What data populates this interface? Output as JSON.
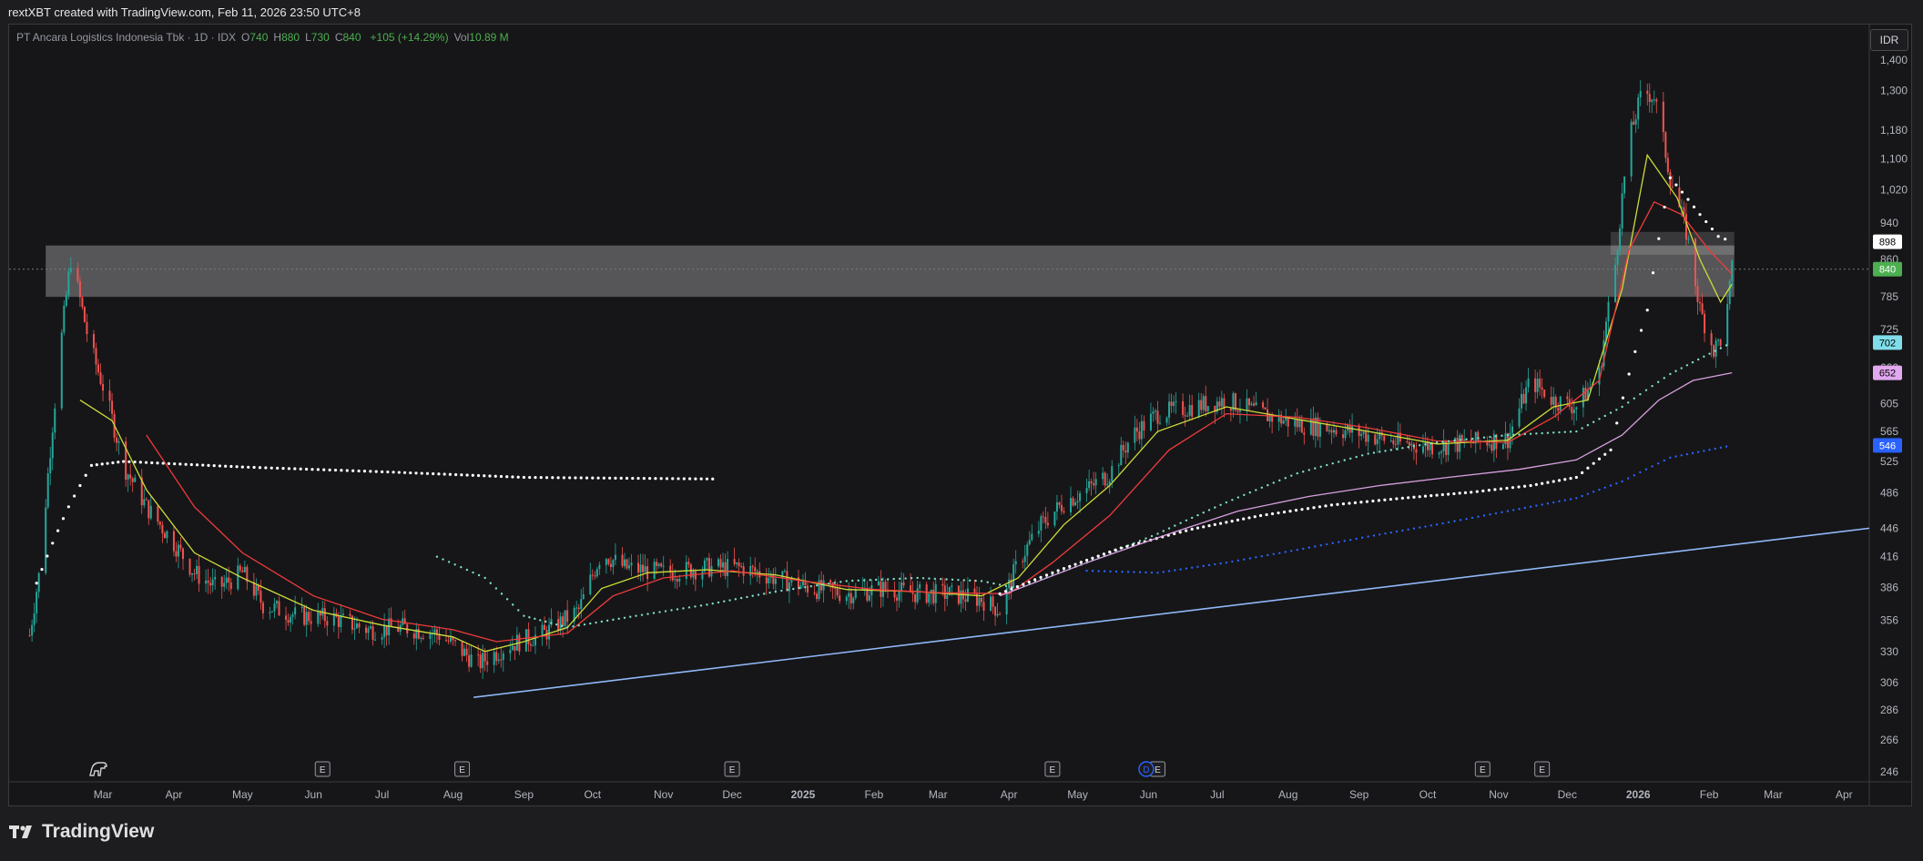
{
  "caption": "rextXBT created with TradingView.com, Feb 11, 2026 23:50 UTC+8",
  "legend": {
    "symbol": "PT Ancara Logistics Indonesia Tbk · 1D · IDX",
    "o_label": "O",
    "o": "740",
    "h_label": "H",
    "h": "880",
    "l_label": "L",
    "l": "730",
    "c_label": "C",
    "c": "840",
    "change": "+105 (+14.29%)",
    "vol_label": "Vol",
    "vol": "10.89 M"
  },
  "currency": "IDR",
  "brand": "TradingView",
  "colors": {
    "up": "#26a69a",
    "down": "#ef5350",
    "sma_fast": "#cddc39",
    "sma_mid": "#ef3b3b",
    "teal_dots": "#7ee0c8",
    "white_dots": "#ffffff",
    "violet": "#d8a0e0",
    "blue_dots": "#2962ff",
    "trendline": "#90b8f8",
    "zone": "#ffffff"
  },
  "chart_data": {
    "type": "line",
    "title": "",
    "xlabel": "",
    "ylabel": "",
    "scale": "log",
    "ylim": [
      240,
      1500
    ],
    "y_ticks": [
      246,
      266,
      286,
      306,
      330,
      356,
      386,
      416,
      446,
      486,
      525,
      565,
      605,
      660,
      725,
      785,
      860,
      940,
      1020,
      1100,
      1180,
      1300,
      1400
    ],
    "x_ticks": [
      "Mar",
      "Apr",
      "May",
      "Jun",
      "Jul",
      "Aug",
      "Sep",
      "Oct",
      "Nov",
      "Dec",
      "2025",
      "Feb",
      "Mar",
      "Apr",
      "May",
      "Jun",
      "Jul",
      "Aug",
      "Sep",
      "Oct",
      "Nov",
      "Dec",
      "2026",
      "Feb",
      "Mar",
      "Apr"
    ],
    "price_tags": [
      {
        "value": 898,
        "color": "#ffffff",
        "text_color": "#000000"
      },
      {
        "value": 840,
        "color": "#4caf50",
        "text_color": "#ffffff"
      },
      {
        "value": 702,
        "color": "#80deea",
        "text_color": "#000000"
      },
      {
        "value": 652,
        "color": "#e1a8f0",
        "text_color": "#000000"
      },
      {
        "value": 546,
        "color": "#2962ff",
        "text_color": "#ffffff"
      }
    ],
    "zones": [
      {
        "from": "2024-02-05",
        "to": "2026-02-12",
        "low": 785,
        "high": 890
      },
      {
        "from": "2025-12-20",
        "to": "2026-02-12",
        "low": 870,
        "high": 920
      }
    ],
    "trendline": {
      "from": [
        "2024-08-10",
        295
      ],
      "to": [
        "2026-04-10",
        446
      ]
    },
    "earnings_markers": [
      "2024-06-05",
      "2024-08-05",
      "2024-12-01",
      "2025-04-20",
      "2025-06-05",
      "2025-10-25",
      "2025-11-20"
    ],
    "dividend_markers": [
      "2025-05-31"
    ],
    "price": [
      [
        "2024-01-28",
        330
      ],
      [
        "2024-02-03",
        410
      ],
      [
        "2024-02-10",
        640
      ],
      [
        "2024-02-16",
        860
      ],
      [
        "2024-02-24",
        700
      ],
      [
        "2024-03-02",
        620
      ],
      [
        "2024-03-10",
        520
      ],
      [
        "2024-03-20",
        470
      ],
      [
        "2024-04-01",
        430
      ],
      [
        "2024-04-10",
        400
      ],
      [
        "2024-04-20",
        385
      ],
      [
        "2024-05-01",
        400
      ],
      [
        "2024-05-10",
        370
      ],
      [
        "2024-05-25",
        360
      ],
      [
        "2024-06-10",
        358
      ],
      [
        "2024-06-25",
        348
      ],
      [
        "2024-07-10",
        350
      ],
      [
        "2024-07-25",
        345
      ],
      [
        "2024-08-05",
        330
      ],
      [
        "2024-08-12",
        320
      ],
      [
        "2024-08-25",
        335
      ],
      [
        "2024-09-10",
        345
      ],
      [
        "2024-09-25",
        365
      ],
      [
        "2024-10-05",
        420
      ],
      [
        "2024-10-15",
        405
      ],
      [
        "2024-11-01",
        400
      ],
      [
        "2024-11-20",
        405
      ],
      [
        "2024-12-05",
        405
      ],
      [
        "2024-12-20",
        395
      ],
      [
        "2025-01-05",
        385
      ],
      [
        "2025-01-20",
        380
      ],
      [
        "2025-02-05",
        385
      ],
      [
        "2025-02-20",
        380
      ],
      [
        "2025-03-05",
        380
      ],
      [
        "2025-03-20",
        375
      ],
      [
        "2025-03-28",
        365
      ],
      [
        "2025-04-05",
        410
      ],
      [
        "2025-04-15",
        450
      ],
      [
        "2025-04-25",
        475
      ],
      [
        "2025-05-05",
        490
      ],
      [
        "2025-05-15",
        510
      ],
      [
        "2025-05-25",
        560
      ],
      [
        "2025-06-05",
        590
      ],
      [
        "2025-06-20",
        600
      ],
      [
        "2025-07-05",
        610
      ],
      [
        "2025-07-20",
        590
      ],
      [
        "2025-08-05",
        575
      ],
      [
        "2025-08-20",
        570
      ],
      [
        "2025-09-05",
        560
      ],
      [
        "2025-09-20",
        548
      ],
      [
        "2025-10-05",
        545
      ],
      [
        "2025-10-20",
        550
      ],
      [
        "2025-11-05",
        555
      ],
      [
        "2025-11-15",
        640
      ],
      [
        "2025-11-25",
        610
      ],
      [
        "2025-12-05",
        600
      ],
      [
        "2025-12-15",
        650
      ],
      [
        "2025-12-22",
        850
      ],
      [
        "2025-12-28",
        1150
      ],
      [
        "2026-01-03",
        1300
      ],
      [
        "2026-01-08",
        1280
      ],
      [
        "2026-01-15",
        1050
      ],
      [
        "2026-01-22",
        920
      ],
      [
        "2026-01-28",
        760
      ],
      [
        "2026-02-03",
        690
      ],
      [
        "2026-02-08",
        720
      ],
      [
        "2026-02-11",
        840
      ]
    ],
    "series": [
      {
        "color": "#cddc39",
        "style": "line",
        "points": [
          [
            "2024-02-20",
            610
          ],
          [
            "2024-03-05",
            580
          ],
          [
            "2024-03-20",
            490
          ],
          [
            "2024-04-10",
            420
          ],
          [
            "2024-05-01",
            395
          ],
          [
            "2024-06-01",
            365
          ],
          [
            "2024-07-01",
            352
          ],
          [
            "2024-08-01",
            342
          ],
          [
            "2024-08-15",
            330
          ],
          [
            "2024-09-01",
            338
          ],
          [
            "2024-09-20",
            350
          ],
          [
            "2024-10-05",
            385
          ],
          [
            "2024-10-25",
            400
          ],
          [
            "2024-11-20",
            403
          ],
          [
            "2024-12-20",
            398
          ],
          [
            "2025-01-20",
            384
          ],
          [
            "2025-02-20",
            382
          ],
          [
            "2025-03-20",
            378
          ],
          [
            "2025-04-05",
            395
          ],
          [
            "2025-04-25",
            450
          ],
          [
            "2025-05-15",
            495
          ],
          [
            "2025-06-05",
            565
          ],
          [
            "2025-07-05",
            600
          ],
          [
            "2025-08-05",
            582
          ],
          [
            "2025-09-05",
            565
          ],
          [
            "2025-10-05",
            548
          ],
          [
            "2025-11-05",
            553
          ],
          [
            "2025-11-25",
            600
          ],
          [
            "2025-12-10",
            610
          ],
          [
            "2025-12-25",
            800
          ],
          [
            "2026-01-05",
            1110
          ],
          [
            "2026-01-18",
            1000
          ],
          [
            "2026-01-28",
            860
          ],
          [
            "2026-02-06",
            775
          ],
          [
            "2026-02-11",
            810
          ]
        ]
      },
      {
        "color": "#ef3b3b",
        "style": "line",
        "points": [
          [
            "2024-03-20",
            560
          ],
          [
            "2024-04-10",
            470
          ],
          [
            "2024-05-01",
            420
          ],
          [
            "2024-06-01",
            378
          ],
          [
            "2024-07-01",
            357
          ],
          [
            "2024-08-01",
            348
          ],
          [
            "2024-08-20",
            338
          ],
          [
            "2024-09-20",
            345
          ],
          [
            "2024-10-10",
            378
          ],
          [
            "2024-11-01",
            395
          ],
          [
            "2024-12-01",
            402
          ],
          [
            "2025-01-01",
            392
          ],
          [
            "2025-02-01",
            384
          ],
          [
            "2025-03-01",
            381
          ],
          [
            "2025-04-01",
            380
          ],
          [
            "2025-04-20",
            410
          ],
          [
            "2025-05-15",
            460
          ],
          [
            "2025-06-10",
            540
          ],
          [
            "2025-07-05",
            590
          ],
          [
            "2025-08-05",
            585
          ],
          [
            "2025-09-05",
            570
          ],
          [
            "2025-10-05",
            552
          ],
          [
            "2025-11-05",
            550
          ],
          [
            "2025-11-25",
            585
          ],
          [
            "2025-12-15",
            640
          ],
          [
            "2025-12-28",
            880
          ],
          [
            "2026-01-08",
            990
          ],
          [
            "2026-01-20",
            960
          ],
          [
            "2026-02-01",
            880
          ],
          [
            "2026-02-11",
            830
          ]
        ]
      },
      {
        "color": "#7ee0c8",
        "style": "dots",
        "points": [
          [
            "2024-07-25",
            416
          ],
          [
            "2024-08-15",
            395
          ],
          [
            "2024-09-01",
            360
          ],
          [
            "2024-09-20",
            350
          ],
          [
            "2024-10-20",
            360
          ],
          [
            "2024-11-20",
            370
          ],
          [
            "2024-12-20",
            382
          ],
          [
            "2025-01-20",
            392
          ],
          [
            "2025-02-20",
            395
          ],
          [
            "2025-03-20",
            392
          ],
          [
            "2025-04-05",
            385
          ],
          [
            "2025-05-05",
            410
          ],
          [
            "2025-06-05",
            440
          ],
          [
            "2025-07-05",
            475
          ],
          [
            "2025-08-05",
            510
          ],
          [
            "2025-09-05",
            535
          ],
          [
            "2025-10-05",
            550
          ],
          [
            "2025-11-05",
            560
          ],
          [
            "2025-12-05",
            565
          ],
          [
            "2025-12-25",
            600
          ],
          [
            "2026-01-15",
            650
          ],
          [
            "2026-02-11",
            702
          ]
        ]
      },
      {
        "color": "#ffffff",
        "style": "dots",
        "points": [
          [
            "2024-02-01",
            390
          ],
          [
            "2024-02-15",
            470
          ],
          [
            "2024-02-25",
            520
          ],
          [
            "2024-03-10",
            525
          ],
          [
            "2024-05-01",
            518
          ],
          [
            "2024-07-01",
            512
          ],
          [
            "2024-09-01",
            505
          ],
          [
            "2024-11-25",
            503
          ]
        ]
      },
      {
        "color": "#ffffff",
        "style": "dots",
        "points": [
          [
            "2025-03-28",
            380
          ],
          [
            "2025-04-20",
            400
          ],
          [
            "2025-05-20",
            425
          ],
          [
            "2025-06-20",
            445
          ],
          [
            "2025-07-20",
            460
          ],
          [
            "2025-08-20",
            472
          ],
          [
            "2025-09-20",
            480
          ],
          [
            "2025-10-20",
            487
          ],
          [
            "2025-11-15",
            495
          ],
          [
            "2025-12-05",
            505
          ],
          [
            "2025-12-20",
            540
          ],
          [
            "2026-01-05",
            760
          ],
          [
            "2026-01-15",
            1050
          ],
          [
            "2026-01-28",
            960
          ],
          [
            "2026-02-05",
            910
          ],
          [
            "2026-02-11",
            898
          ]
        ]
      },
      {
        "color": "#d8a0e0",
        "style": "line",
        "points": [
          [
            "2025-03-28",
            378
          ],
          [
            "2025-05-05",
            410
          ],
          [
            "2025-06-10",
            440
          ],
          [
            "2025-07-10",
            465
          ],
          [
            "2025-08-10",
            482
          ],
          [
            "2025-09-10",
            495
          ],
          [
            "2025-10-10",
            505
          ],
          [
            "2025-11-10",
            515
          ],
          [
            "2025-12-05",
            527
          ],
          [
            "2025-12-25",
            560
          ],
          [
            "2026-01-10",
            610
          ],
          [
            "2026-01-25",
            640
          ],
          [
            "2026-02-11",
            652
          ]
        ]
      },
      {
        "color": "#2962ff",
        "style": "dots",
        "points": [
          [
            "2025-05-05",
            402
          ],
          [
            "2025-06-05",
            400
          ],
          [
            "2025-07-05",
            410
          ],
          [
            "2025-08-05",
            423
          ],
          [
            "2025-09-05",
            437
          ],
          [
            "2025-10-05",
            450
          ],
          [
            "2025-11-05",
            465
          ],
          [
            "2025-12-05",
            480
          ],
          [
            "2025-12-25",
            500
          ],
          [
            "2026-01-15",
            530
          ],
          [
            "2026-02-11",
            546
          ]
        ]
      }
    ]
  }
}
